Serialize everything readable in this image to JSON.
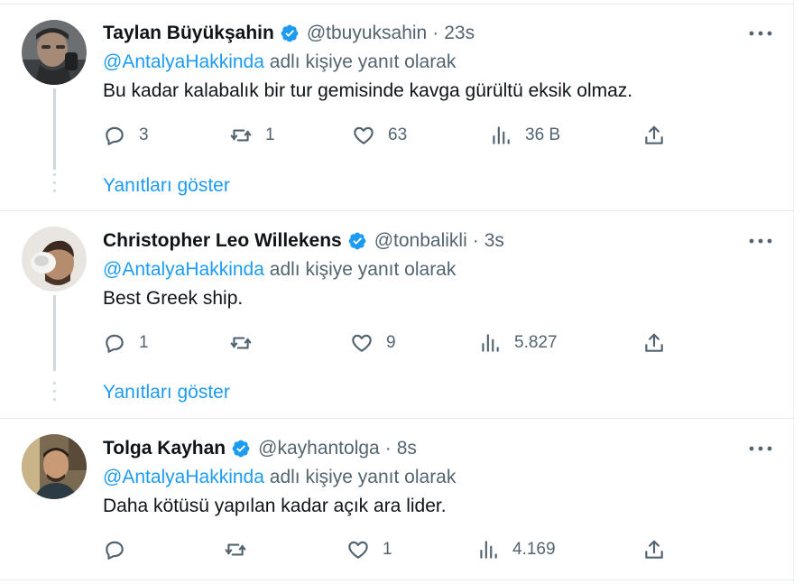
{
  "reply_prefix_suffix": "adlı kişiye yanıt olarak",
  "show_replies_label": "Yanıtları göster",
  "colors": {
    "accent": "#1d9bf0",
    "secondary_text": "#536471",
    "primary_text": "#0f1419"
  },
  "icons": [
    "verified-badge-icon",
    "more-icon",
    "reply-icon",
    "retweet-icon",
    "like-icon",
    "views-icon",
    "share-icon"
  ],
  "tweets": [
    {
      "name": "Taylan Büyükşahin",
      "handle": "@tbuyuksahin",
      "sep": "·",
      "time": "23s",
      "mention": "@AntalyaHakkinda",
      "text": "Bu kadar kalabalık bir tur gemisinde kavga gürültü eksik olmaz.",
      "replies": "3",
      "retweets": "1",
      "likes": "63",
      "views": "36 B"
    },
    {
      "name": "Christopher Leo Willekens",
      "handle": "@tonbalikli",
      "sep": "·",
      "time": "3s",
      "mention": "@AntalyaHakkinda",
      "text": "Best Greek ship.",
      "replies": "1",
      "retweets": "",
      "likes": "9",
      "views": "5.827"
    },
    {
      "name": "Tolga Kayhan",
      "handle": "@kayhantolga",
      "sep": "·",
      "time": "8s",
      "mention": "@AntalyaHakkinda",
      "text": "Daha kötüsü yapılan kadar açık ara lider.",
      "replies": "",
      "retweets": "",
      "likes": "1",
      "views": "4.169"
    }
  ]
}
